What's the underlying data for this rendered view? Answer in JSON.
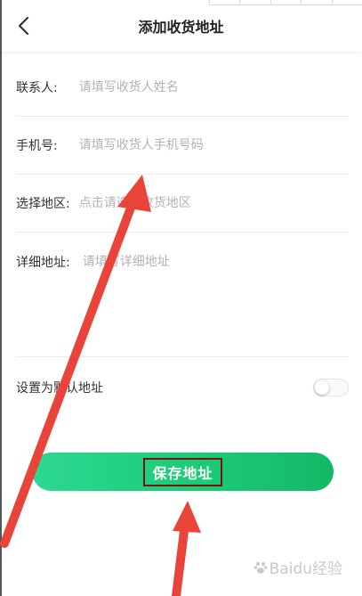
{
  "header": {
    "title": "添加收货地址",
    "back_icon": "chevron-left-icon"
  },
  "form": {
    "contact": {
      "label": "联系人:",
      "placeholder": "请填写收货人姓名"
    },
    "phone": {
      "label": "手机号:",
      "placeholder": "请填写收货人手机号码"
    },
    "region": {
      "label": "选择地区:",
      "placeholder": "点击请选择收货地区"
    },
    "detail": {
      "label": "详细地址:",
      "placeholder": "请填写详细地址"
    }
  },
  "default_address": {
    "label": "设置为默认地址",
    "enabled": false
  },
  "save_button": {
    "label": "保存地址"
  },
  "watermark": {
    "text": "Baidu经验",
    "icon": "baidu-paw-icon"
  },
  "colors": {
    "accent_start": "#2ed890",
    "accent_end": "#14b865",
    "annotation_arrow": "#e8443a",
    "annotation_box": "#7a1010"
  }
}
